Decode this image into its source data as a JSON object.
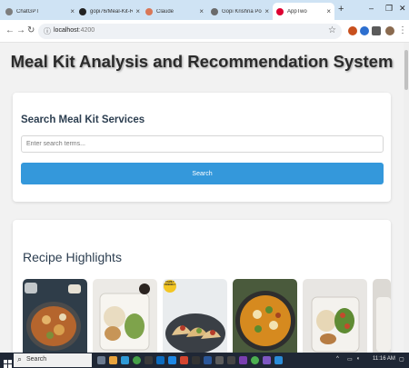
{
  "browser": {
    "tabs": [
      {
        "title": "ChatGPT",
        "active": false,
        "favicon_color": "#7d7d7d"
      },
      {
        "title": "gopi76/Meal-Kit-Recom",
        "active": false,
        "favicon_color": "#222222"
      },
      {
        "title": "Claude",
        "active": false,
        "favicon_color": "#d97757"
      },
      {
        "title": "Gopi Krishna Portfolio",
        "active": false,
        "favicon_color": "#6b6b6b"
      },
      {
        "title": "AppTwo",
        "active": true,
        "favicon_color": "#dd0031"
      }
    ],
    "new_tab_icon": "+",
    "window_controls": {
      "minimize": "–",
      "restore": "❐",
      "close": "✕"
    },
    "url_host": "localhost",
    "url_port": ":4200"
  },
  "page": {
    "title": "Meal Kit Analysis and Recommendation System",
    "search": {
      "heading": "Search Meal Kit Services",
      "placeholder": "Enter search terms...",
      "button_label": "Search",
      "button_color": "#3498db"
    },
    "recipes": {
      "heading": "Recipe Highlights",
      "items": [
        {
          "name": "pasta-skillet",
          "badge": ""
        },
        {
          "name": "rice-tray-with-sauce",
          "badge": ""
        },
        {
          "name": "tacos-platter",
          "badge": "FAMILY FRIENDLY"
        },
        {
          "name": "curry-skillet",
          "badge": ""
        },
        {
          "name": "greens-tray",
          "badge": ""
        },
        {
          "name": "partial-card",
          "badge": ""
        }
      ]
    }
  },
  "taskbar": {
    "search_label": "Search",
    "time": "11:16 AM"
  }
}
